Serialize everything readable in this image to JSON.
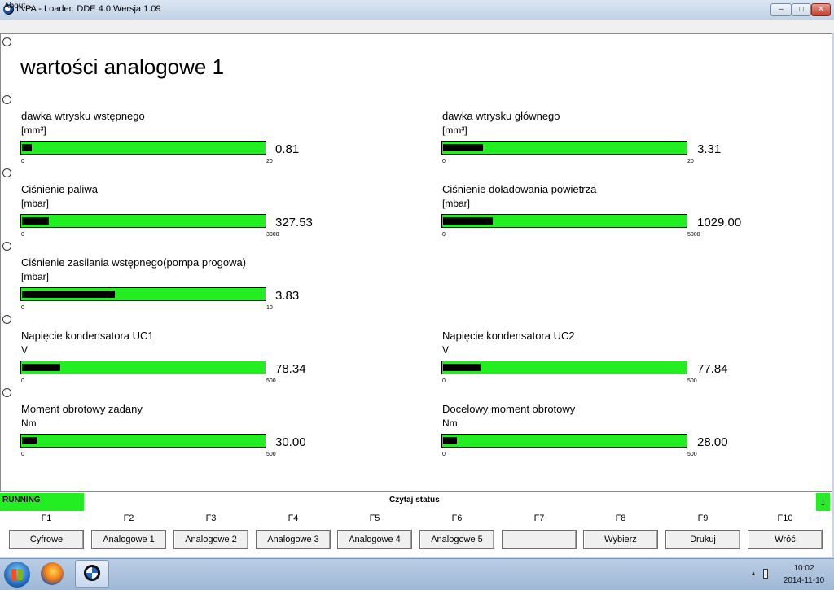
{
  "window": {
    "title": "INPA - Loader:  DDE 4.0 Wersja 1.09",
    "minimize_glyph": "–",
    "maximize_glyph": "□",
    "close_glyph": "✕"
  },
  "menu": {
    "about": "About..."
  },
  "page": {
    "title": "wartości analogowe 1"
  },
  "gauges": {
    "g1": {
      "label": "dawka wtrysku wstępnego",
      "unit": "[mm³]",
      "value": "0.81",
      "min": "0",
      "max": "20",
      "fraction": 0.0405
    },
    "g2": {
      "label": "dawka wtrysku głównego",
      "unit": "[mm³]",
      "value": "3.31",
      "min": "0",
      "max": "20",
      "fraction": 0.1655
    },
    "g3": {
      "label": "Ciśnienie paliwa",
      "unit": "[mbar]",
      "value": "327.53",
      "min": "0",
      "max": "3000",
      "fraction": 0.1092
    },
    "g4": {
      "label": "Ciśnienie doładowania powietrza",
      "unit": "[mbar]",
      "value": "1029.00",
      "min": "0",
      "max": "5000",
      "fraction": 0.2058
    },
    "g5": {
      "label": "Ciśnienie zasilania wstępnego(pompa progowa)",
      "unit": "[mbar]",
      "value": "3.83",
      "min": "0",
      "max": "10",
      "fraction": 0.383
    },
    "g6": {
      "label": "Napięcie kondensatora UC1",
      "unit": "V",
      "value": "78.34",
      "min": "0",
      "max": "500",
      "fraction": 0.1567
    },
    "g7": {
      "label": "Napięcie kondensatora UC2",
      "unit": "V",
      "value": "77.84",
      "min": "0",
      "max": "500",
      "fraction": 0.1557
    },
    "g8": {
      "label": "Moment obrotowy zadany",
      "unit": "Nm",
      "value": "30.00",
      "min": "0",
      "max": "500",
      "fraction": 0.06
    },
    "g9": {
      "label": "Docelowy moment obrotowy",
      "unit": "Nm",
      "value": "28.00",
      "min": "0",
      "max": "500",
      "fraction": 0.056
    }
  },
  "status": {
    "state": "RUNNING",
    "text": "Czytaj status",
    "arrow": "↓"
  },
  "fkeys": [
    {
      "key": "F1",
      "label": "Cyfrowe"
    },
    {
      "key": "F2",
      "label": "Analogowe 1"
    },
    {
      "key": "F3",
      "label": "Analogowe 2"
    },
    {
      "key": "F4",
      "label": "Analogowe 3"
    },
    {
      "key": "F5",
      "label": "Analogowe 4"
    },
    {
      "key": "F6",
      "label": "Analogowe 5"
    },
    {
      "key": "F7",
      "label": ""
    },
    {
      "key": "F8",
      "label": "Wybierz"
    },
    {
      "key": "F9",
      "label": "Drukuj"
    },
    {
      "key": "F10",
      "label": "Wróć"
    }
  ],
  "colors": {
    "bar_green": "#22ee22",
    "bar_fill": "#000000"
  },
  "taskbar": {
    "icons": [
      "windows-start-icon",
      "firefox-icon",
      "bmw-inpa-icon"
    ],
    "tray_arrow": "▲",
    "clock_time": "10:02",
    "clock_date": "2014-11-10"
  }
}
